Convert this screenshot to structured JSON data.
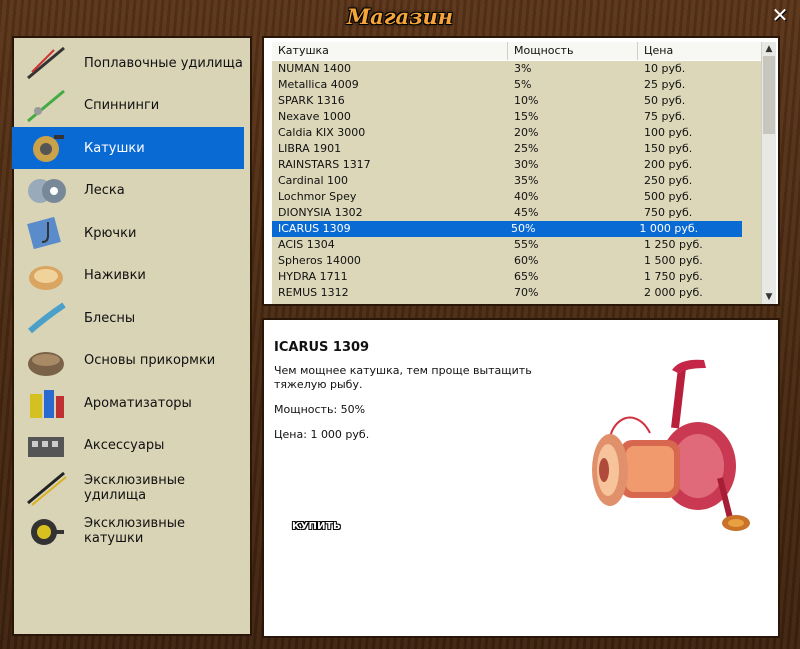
{
  "window": {
    "title": "Магазин",
    "close_label": "✕"
  },
  "sidebar": {
    "items": [
      {
        "label": "Поплавочные удилища",
        "icon": "float-rod-icon"
      },
      {
        "label": "Спиннинги",
        "icon": "spinning-rod-icon"
      },
      {
        "label": "Катушки",
        "icon": "reel-icon",
        "selected": true
      },
      {
        "label": "Леска",
        "icon": "fishing-line-icon"
      },
      {
        "label": "Крючки",
        "icon": "hooks-icon"
      },
      {
        "label": "Наживки",
        "icon": "bait-icon"
      },
      {
        "label": "Блесны",
        "icon": "lure-icon"
      },
      {
        "label": "Основы прикормки",
        "icon": "groundbait-icon"
      },
      {
        "label": "Ароматизаторы",
        "icon": "flavoring-icon"
      },
      {
        "label": "Аксессуары",
        "icon": "accessories-icon"
      },
      {
        "label": "Эксклюзивные удилища",
        "icon": "exclusive-rod-icon"
      },
      {
        "label": "Эксклюзивные катушки",
        "icon": "exclusive-reel-icon"
      }
    ]
  },
  "table": {
    "headers": [
      "Катушка",
      "Мощность",
      "Цена"
    ],
    "rows": [
      [
        "NUMAN 1400",
        "3%",
        "10 руб."
      ],
      [
        "Metallica 4009",
        "5%",
        "25 руб."
      ],
      [
        "SPARK 1316",
        "10%",
        "50 руб."
      ],
      [
        "Nexave 1000",
        "15%",
        "75 руб."
      ],
      [
        "Caldia KIX 3000",
        "20%",
        "100 руб."
      ],
      [
        "LIBRA 1901",
        "25%",
        "150 руб."
      ],
      [
        "RAINSTARS 1317",
        "30%",
        "200 руб."
      ],
      [
        "Cardinal 100",
        "35%",
        "250 руб."
      ],
      [
        "Lochmor Spey",
        "40%",
        "500 руб."
      ],
      [
        "DIONYSIA 1302",
        "45%",
        "750 руб."
      ],
      [
        "ICARUS 1309",
        "50%",
        "1 000 руб."
      ],
      [
        "ACIS 1304",
        "55%",
        "1 250 руб."
      ],
      [
        "Spheros 14000",
        "60%",
        "1 500 руб."
      ],
      [
        "HYDRA 1711",
        "65%",
        "1 750 руб."
      ],
      [
        "REMUS 1312",
        "70%",
        "2 000 руб."
      ]
    ],
    "selected_row": "ICARUS 1309"
  },
  "detail": {
    "name": "ICARUS 1309",
    "description": "Чем мощнее катушка, тем проще вытащить тяжелую рыбу.",
    "power": "Мощность: 50%",
    "price": "Цена: 1 000 руб.",
    "buy_label": "КУПИТЬ",
    "image_icon": "spinning-reel-image"
  }
}
